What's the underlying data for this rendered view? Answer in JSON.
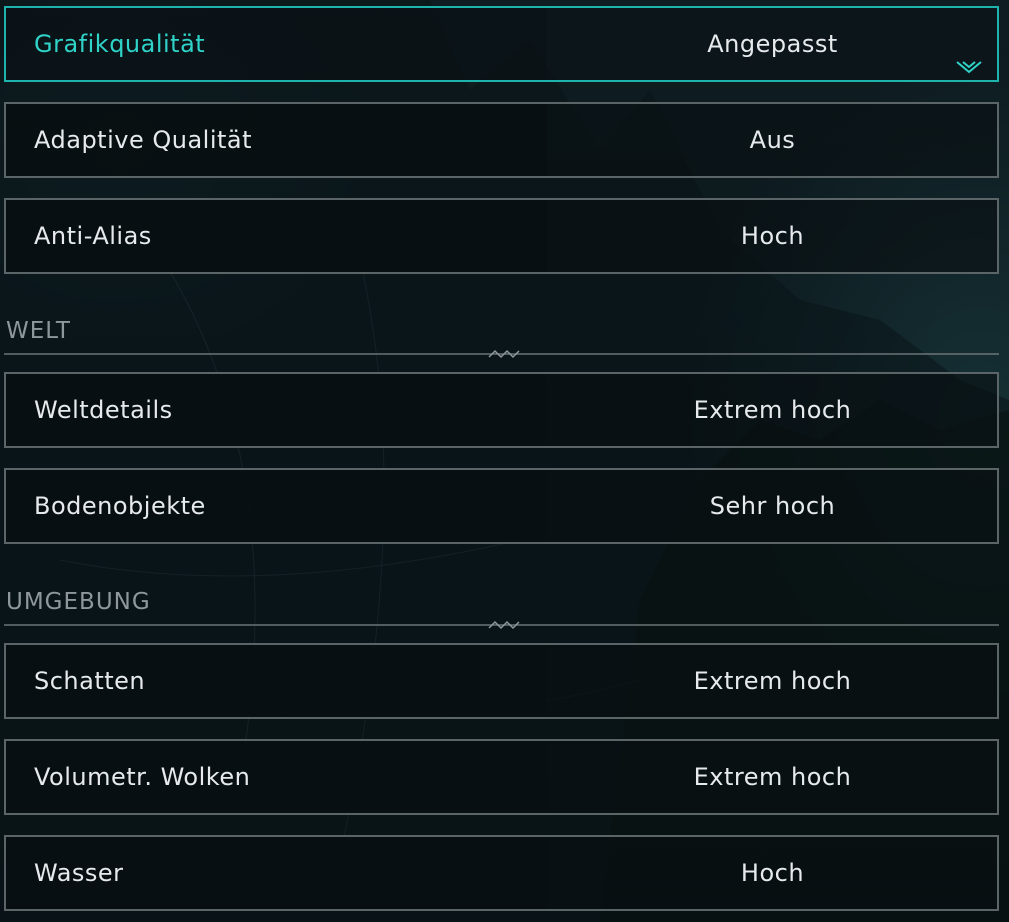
{
  "settings": {
    "graphics_quality": {
      "label": "Grafikqualität",
      "value": "Angepasst"
    },
    "adaptive_quality": {
      "label": "Adaptive Qualität",
      "value": "Aus"
    },
    "anti_alias": {
      "label": "Anti-Alias",
      "value": "Hoch"
    },
    "world": {
      "title": "WELT",
      "world_details": {
        "label": "Weltdetails",
        "value": "Extrem hoch"
      },
      "ground_objects": {
        "label": "Bodenobjekte",
        "value": "Sehr hoch"
      }
    },
    "environment": {
      "title": "UMGEBUNG",
      "shadows": {
        "label": "Schatten",
        "value": "Extrem hoch"
      },
      "volumetric_clouds": {
        "label": "Volumetr. Wolken",
        "value": "Extrem hoch"
      },
      "water": {
        "label": "Wasser",
        "value": "Hoch"
      }
    }
  },
  "colors": {
    "accent": "#2fd3c8",
    "row_border": "#5b6467",
    "section_text": "#8e989c",
    "text": "#e6eaec"
  },
  "icons": {
    "selected_dropdown": "chevron-down-icon",
    "divider_ornament": "zigzag-ornament-icon"
  }
}
